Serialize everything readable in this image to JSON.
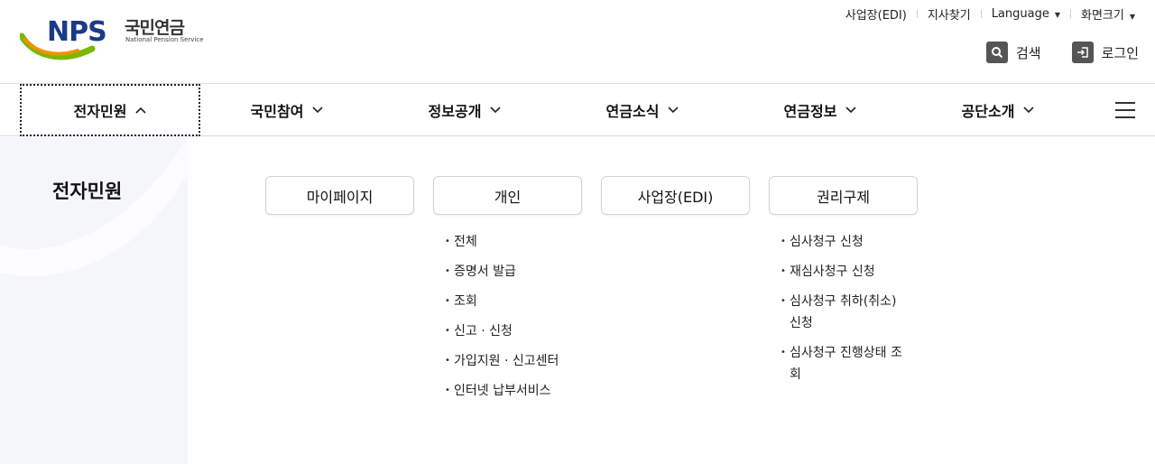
{
  "logo": {
    "brand": "NPS",
    "name_ko": "국민연금",
    "name_en": "National Pension Service"
  },
  "util": {
    "business": "사업장(EDI)",
    "branch": "지사찾기",
    "language": "Language",
    "screen_size": "화면크기"
  },
  "actions": {
    "search": "검색",
    "login": "로그인"
  },
  "gnb": {
    "items": [
      "전자민원",
      "국민참여",
      "정보공개",
      "연금소식",
      "연금정보",
      "공단소개"
    ],
    "active_index": 0,
    "menu_icon": "hamburger-menu-icon"
  },
  "mega": {
    "title": "전자민원",
    "columns": [
      {
        "label": "마이페이지",
        "links": []
      },
      {
        "label": "개인",
        "links": [
          "전체",
          "증명서 발급",
          "조회",
          "신고 · 신청",
          "가입지원 · 신고센터",
          "인터넷 납부서비스"
        ]
      },
      {
        "label": "사업장(EDI)",
        "links": []
      },
      {
        "label": "권리구제",
        "links": [
          "심사청구 신청",
          "재심사청구 신청",
          "심사청구 취하(취소) 신청",
          "심사청구 진행상태 조회"
        ]
      }
    ]
  },
  "colors": {
    "brand_navy": "#1b3a8a",
    "brand_green": "#7ab800",
    "brand_orange": "#f39200",
    "side_bg": "#f4f6fa"
  }
}
